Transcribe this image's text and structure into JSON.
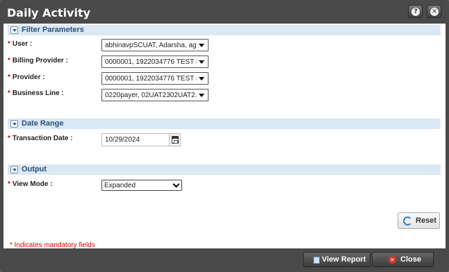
{
  "window": {
    "title": "Daily Activity",
    "help_icon": "question-icon",
    "close_icon": "close-x-icon"
  },
  "filter_parameters": {
    "header": "Filter Parameters",
    "fields": [
      {
        "label": "User :",
        "value": "abhinavpSCUAT, Adarsha, ag..."
      },
      {
        "label": "Billing Provider :",
        "value": "0000001, 1922034776 TEST I..."
      },
      {
        "label": "Provider :",
        "value": "0000001, 1922034776 TEST I..."
      },
      {
        "label": "Business Line :",
        "value": "0220payer, 02UAT2302UAT2..."
      }
    ]
  },
  "date_range": {
    "header": "Date Range",
    "label": "Transaction Date :",
    "value": "10/29/2024"
  },
  "output": {
    "header": "Output",
    "label": "View Mode :",
    "value": "Expanded"
  },
  "required_marker": "*",
  "reset_label": "Reset",
  "mandatory_note": "* Indicates mandatory fields",
  "footer": {
    "view_report_label": "View Report",
    "close_label": "Close"
  },
  "colors": {
    "section_header_bg": "#dbe8f5",
    "section_header_text": "#2d4f7a",
    "required": "#cc0000",
    "dialog_frame": "#4a4a4a"
  }
}
